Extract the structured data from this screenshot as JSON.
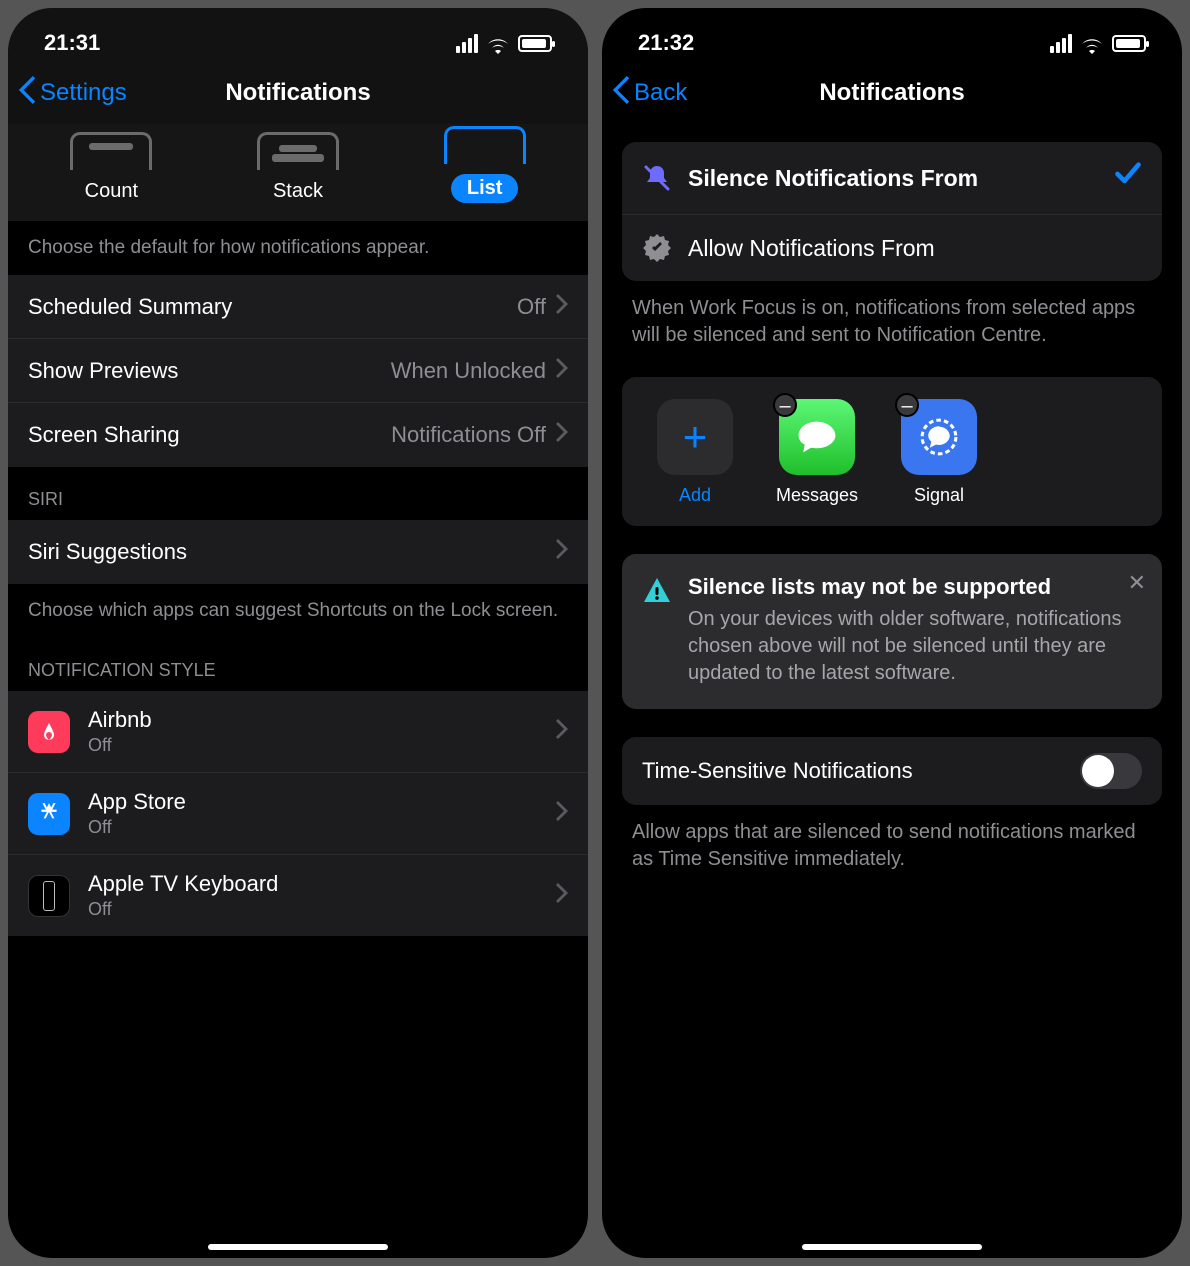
{
  "left": {
    "status": {
      "time": "21:31"
    },
    "nav": {
      "back": "Settings",
      "title": "Notifications"
    },
    "display_as": {
      "items": [
        {
          "label": "Count",
          "selected": false
        },
        {
          "label": "Stack",
          "selected": false
        },
        {
          "label": "List",
          "selected": true
        }
      ]
    },
    "display_footer": "Choose the default for how notifications appear.",
    "settings_rows": [
      {
        "label": "Scheduled Summary",
        "value": "Off"
      },
      {
        "label": "Show Previews",
        "value": "When Unlocked"
      },
      {
        "label": "Screen Sharing",
        "value": "Notifications Off"
      }
    ],
    "siri": {
      "header": "SIRI",
      "row_label": "Siri Suggestions",
      "footer": "Choose which apps can suggest Shortcuts on the Lock screen."
    },
    "style": {
      "header": "NOTIFICATION STYLE",
      "apps": [
        {
          "name": "Airbnb",
          "sub": "Off",
          "icon": "airbnb",
          "bg": "#ff3b5c"
        },
        {
          "name": "App Store",
          "sub": "Off",
          "icon": "appstore",
          "bg": "#0a84ff"
        },
        {
          "name": "Apple TV Keyboard",
          "sub": "Off",
          "icon": "tvremote",
          "bg": "#000000"
        }
      ]
    }
  },
  "right": {
    "status": {
      "time": "21:32"
    },
    "nav": {
      "back": "Back",
      "title": "Notifications"
    },
    "modes": {
      "silence": "Silence Notifications From",
      "allow": "Allow Notifications From",
      "selected": "silence",
      "footer": "When Work Focus is on, notifications from selected apps will be silenced and sent to Notification Centre."
    },
    "apps": {
      "add_label": "Add",
      "items": [
        {
          "name": "Messages",
          "icon": "messages",
          "bg": "linear-gradient(#5df777,#1fbf2b)"
        },
        {
          "name": "Signal",
          "icon": "signal",
          "bg": "#3a76f0"
        }
      ]
    },
    "warning": {
      "title": "Silence lists may not be supported",
      "msg": "On your devices with older software, notifications chosen above will not be silenced until they are updated to the latest software."
    },
    "time_sensitive": {
      "label": "Time-Sensitive Notifications",
      "on": false,
      "footer": "Allow apps that are silenced to send notifications marked as Time Sensitive immediately."
    }
  }
}
